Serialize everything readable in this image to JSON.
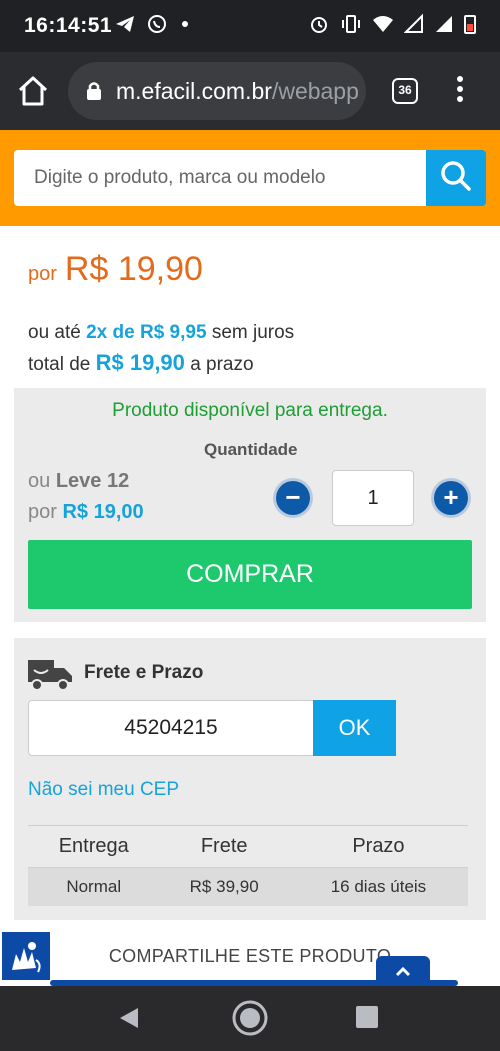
{
  "status_bar": {
    "time": "16:14:51"
  },
  "browser": {
    "url_main": "m.efacil.com.br",
    "url_path": "/webapp",
    "tab_count": "36"
  },
  "search": {
    "placeholder": "Digite o produto, marca ou modelo"
  },
  "price": {
    "prefix": "por",
    "value": "R$ 19,90"
  },
  "installments": {
    "line1_prefix": "ou até",
    "line1_value": "2x de R$ 9,95",
    "line1_suffix": "sem juros",
    "line2_prefix": "total de",
    "line2_value": "R$ 19,90",
    "line2_suffix": "a prazo"
  },
  "purchase": {
    "availability": "Produto disponível para entrega.",
    "quantity_label": "Quantidade",
    "bulk_prefix": "ou",
    "bulk_label": "Leve 12",
    "bulk_price_prefix": "por",
    "bulk_price": "R$ 19,00",
    "quantity_value": "1",
    "minus_symbol": "−",
    "plus_symbol": "+",
    "buy_label": "COMPRAR"
  },
  "freight": {
    "title": "Frete e Prazo",
    "cep_value": "45204215",
    "ok_label": "OK",
    "unknown_cep_link": "Não sei meu CEP",
    "table": {
      "headers": [
        "Entrega",
        "Frete",
        "Prazo"
      ],
      "rows": [
        [
          "Normal",
          "R$ 39,90",
          "16 dias úteis"
        ]
      ]
    }
  },
  "share": {
    "label": "COMPARTILHE ESTE PRODUTO"
  },
  "colors": {
    "orange": "#ff9a00",
    "price_orange": "#e46b1b",
    "accent_blue": "#0fa3e6",
    "buy_green": "#1ec96e",
    "available_green": "#1e9e34",
    "dark_blue": "#0c4aa6"
  },
  "icons": {
    "status": [
      "telegram-icon",
      "whatsapp-icon",
      "dot-icon",
      "alarm-icon",
      "vibrate-icon",
      "wifi-icon",
      "signal-icon",
      "signal-icon",
      "battery-icon"
    ],
    "browser": [
      "home-icon",
      "lock-icon",
      "tabs-icon",
      "more-vert-icon"
    ],
    "page": [
      "search-icon",
      "truck-icon",
      "libras-icon",
      "chevron-up-icon"
    ],
    "nav": [
      "back-icon",
      "home-circle-icon",
      "recents-icon"
    ]
  }
}
